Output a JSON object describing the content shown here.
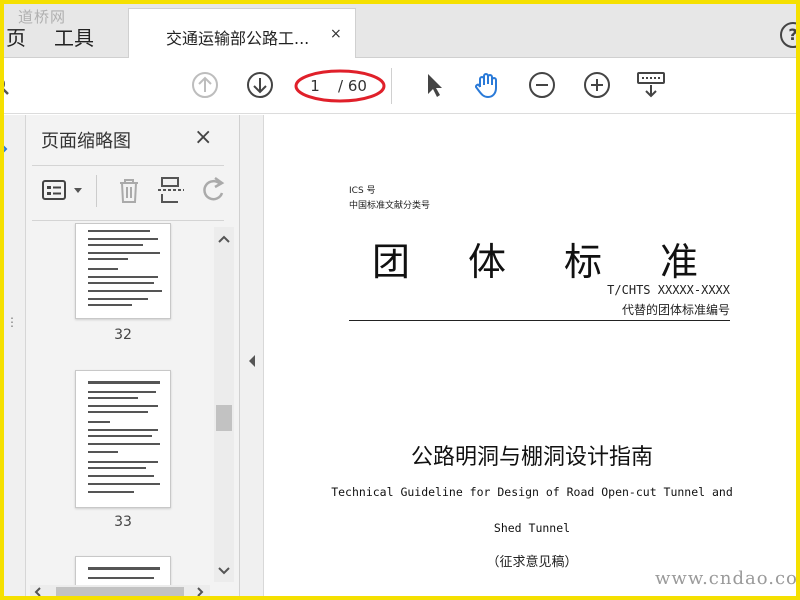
{
  "tabbar": {
    "menu_items": [
      "页",
      "工具"
    ],
    "doc_tab_title": "交通运输部公路工...",
    "close_glyph": "×",
    "help_glyph": "?"
  },
  "toolbar": {
    "page_current": "1",
    "page_total": "/ 60",
    "annotation_color": "#e0202a",
    "accent_color": "#2a7ad8"
  },
  "thumbnail_panel": {
    "title": "页面缩略图",
    "close_glyph": "×",
    "thumbnails": [
      {
        "label": "32"
      },
      {
        "label": "33"
      }
    ]
  },
  "document": {
    "ics": "ICS 号",
    "classification": "中国标准文献分类号",
    "big_title": "团体标准",
    "code": "T/CHTS XXXXX-XXXX",
    "replaced_code": "代替的团体标准编号",
    "cn_title": "公路明洞与棚洞设计指南",
    "en_title_line1": "Technical Guideline for Design of Road Open-cut Tunnel and",
    "en_title_line2": "Shed Tunnel",
    "draft_note": "（征求意见稿）"
  },
  "watermarks": {
    "top": "道桥网",
    "bottom": "www.cndao.com"
  }
}
